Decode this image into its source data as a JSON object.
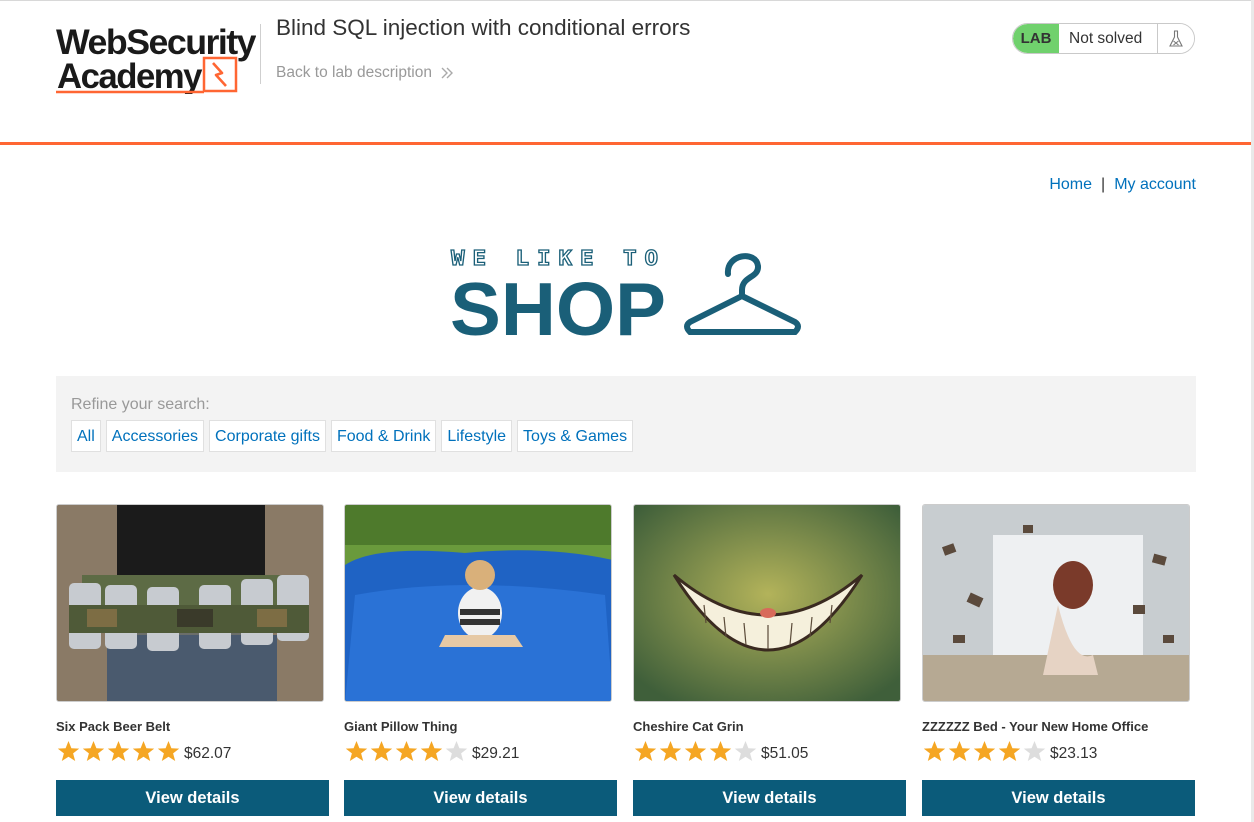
{
  "header": {
    "logo_line1": "WebSecurity",
    "logo_line2": "Academy",
    "lab_title": "Blind SQL injection with conditional errors",
    "back_link": "Back to lab description",
    "lab_badge": "LAB",
    "lab_status": "Not solved",
    "lab_icon": "flask-icon"
  },
  "nav": {
    "home": "Home",
    "separator": "|",
    "account": "My account"
  },
  "banner": {
    "line1": "WE LIKE TO",
    "line2": "SHOP",
    "icon": "hanger-icon"
  },
  "filter": {
    "label": "Refine your search:",
    "categories": [
      "All",
      "Accessories",
      "Corporate gifts",
      "Food & Drink",
      "Lifestyle",
      "Toys & Games"
    ]
  },
  "products": [
    {
      "name": "Six Pack Beer Belt",
      "rating": 5,
      "max_rating": 5,
      "price": "$62.07",
      "button": "View details"
    },
    {
      "name": "Giant Pillow Thing",
      "rating": 4,
      "max_rating": 5,
      "price": "$29.21",
      "button": "View details"
    },
    {
      "name": "Cheshire Cat Grin",
      "rating": 4,
      "max_rating": 5,
      "price": "$51.05",
      "button": "View details"
    },
    {
      "name": "ZZZZZZ Bed - Your New Home Office",
      "rating": 4,
      "max_rating": 5,
      "price": "$23.13",
      "button": "View details"
    }
  ],
  "colors": {
    "accent_orange": "#ff6633",
    "link_blue": "#0071bc",
    "button_blue": "#0b5b7a",
    "lab_green": "#70d16d",
    "star_filled": "#f5a623",
    "star_empty": "#dddddd"
  }
}
